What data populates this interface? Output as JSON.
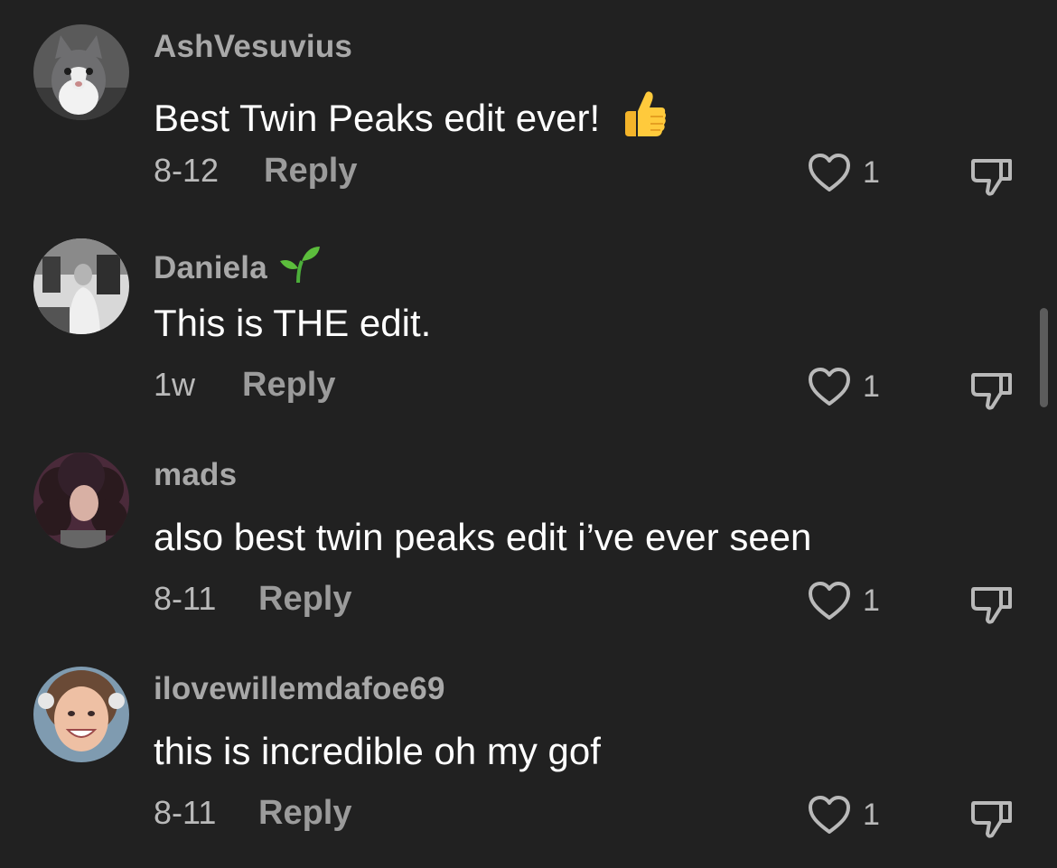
{
  "reply_label": "Reply",
  "colors": {
    "background": "#212121",
    "username": "#a8a8a8",
    "text": "#ffffff",
    "meta": "#b9b9b9",
    "reply": "#9b9b9b",
    "scrollbar": "#5c5c5c"
  },
  "comments": [
    {
      "username": "AshVesuvius",
      "text": "Best Twin Peaks edit ever!",
      "text_emoji": "thumbs-up",
      "date": "8-12",
      "like_count": "1",
      "avatar": "cat-avatar"
    },
    {
      "username": "Daniela",
      "username_emoji": "seedling",
      "text": "This is THE edit.",
      "date": "1w",
      "like_count": "1",
      "avatar": "photo-avatar-bw"
    },
    {
      "username": "mads",
      "text": "also best twin peaks edit i’ve ever seen",
      "date": "8-11",
      "like_count": "1",
      "avatar": "curly-hair-avatar"
    },
    {
      "username": "ilovewillemdafoe69",
      "text": "this is incredible oh my gof",
      "date": "8-11",
      "like_count": "1",
      "avatar": "smiling-face-avatar"
    }
  ]
}
